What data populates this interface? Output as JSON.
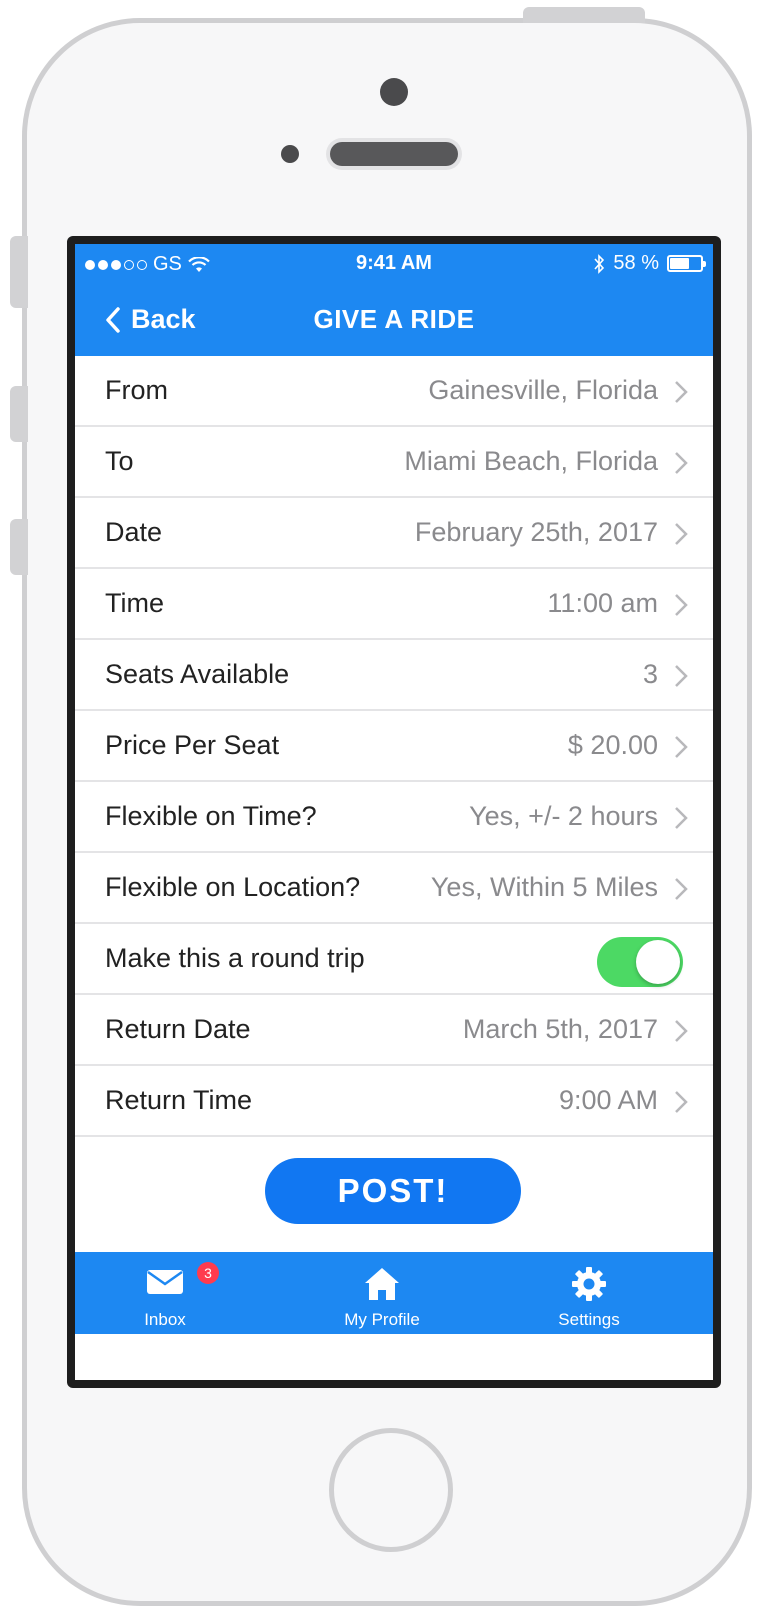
{
  "status_bar": {
    "carrier": "GS",
    "time": "9:41 AM",
    "battery_percent": "58 %",
    "battery_level": 0.58
  },
  "nav": {
    "back_label": "Back",
    "title": "GIVE A RIDE"
  },
  "form": {
    "rows": [
      {
        "label": "From",
        "value": "Gainesville, Florida"
      },
      {
        "label": "To",
        "value": "Miami Beach, Florida"
      },
      {
        "label": "Date",
        "value": "February 25th, 2017"
      },
      {
        "label": "Time",
        "value": "11:00 am"
      },
      {
        "label": "Seats Available",
        "value": "3"
      },
      {
        "label": "Price Per Seat",
        "value": "$ 20.00"
      },
      {
        "label": "Flexible on Time?",
        "value": "Yes, +/- 2 hours"
      },
      {
        "label": "Flexible on Location?",
        "value": "Yes, Within 5 Miles"
      }
    ],
    "round_trip": {
      "label": "Make this a round trip",
      "enabled": true
    },
    "return_rows": [
      {
        "label": "Return Date",
        "value": "March 5th, 2017"
      },
      {
        "label": "Return Time",
        "value": "9:00 AM"
      }
    ]
  },
  "post_button": "POST!",
  "tab_bar": {
    "inbox": {
      "label": "Inbox",
      "badge": "3",
      "icon": "envelope-icon"
    },
    "profile": {
      "label": "My Profile",
      "icon": "home-icon"
    },
    "settings": {
      "label": "Settings",
      "icon": "gear-icon"
    }
  },
  "colors": {
    "accent": "#1d88f2",
    "button": "#1177f2",
    "toggle_on": "#4cd964",
    "badge": "#ff3b4e"
  }
}
